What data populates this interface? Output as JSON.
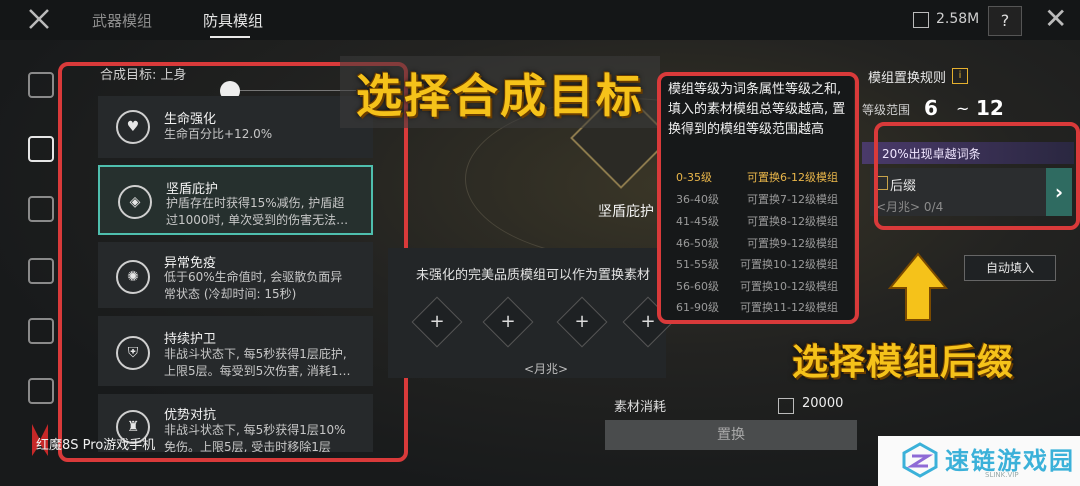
{
  "header": {
    "tabs": [
      {
        "label": "武器模组"
      },
      {
        "label": "防具模组"
      }
    ],
    "storage": "2.58M",
    "help": "?"
  },
  "left": {
    "target_label": "合成目标: 上身",
    "items": [
      {
        "name": "生命强化",
        "desc": "生命百分比+12.0%"
      },
      {
        "name": "坚盾庇护",
        "desc": "护盾存在时获得15%减伤, 护盾超\n过1000时, 单次受到的伤害无法…"
      },
      {
        "name": "异常免疫",
        "desc": "低于60%生命值时, 会驱散负面异\n常状态 (冷却时间: 15秒)"
      },
      {
        "name": "持续护卫",
        "desc": "非战斗状态下, 每5秒获得1层庇护,\n上限5层。每受到5次伤害, 消耗1…"
      },
      {
        "name": "优势对抗",
        "desc": "非战斗状态下, 每5秒获得1层10%\n免伤。上限5层, 受击时移除1层"
      }
    ]
  },
  "center": {
    "banner": "选择合成目标",
    "selected_name": "坚盾庇护",
    "slots_label": "未强化的完美品质模组可以作为置换素材",
    "slot_plus": "+",
    "slot_caption": "<月兆>",
    "cost_label": "素材消耗",
    "cost_value": "20000",
    "replace_button": "置换"
  },
  "popup": {
    "text": "模组等级为词条属性等级之和, 填入的素材模组总等级越高, 置换得到的模组等级范围越高",
    "tiers": [
      {
        "range": "0-35级",
        "result": "可置换6-12级模组"
      },
      {
        "range": "36-40级",
        "result": "可置换7-12级模组"
      },
      {
        "range": "41-45级",
        "result": "可置换8-12级模组"
      },
      {
        "range": "46-50级",
        "result": "可置换9-12级模组"
      },
      {
        "range": "51-55级",
        "result": "可置换10-12级模组"
      },
      {
        "range": "56-60级",
        "result": "可置换10-12级模组"
      },
      {
        "range": "61-90级",
        "result": "可置换11-12级模组"
      }
    ]
  },
  "right": {
    "rule_title": "模组置换规则",
    "info": "i",
    "level_label": "等级范围",
    "level_min": "6",
    "tilde": "~",
    "level_max": "12",
    "bonus": "20%出现卓越词条",
    "suffix_label": "后缀",
    "suffix_count": "<月兆> 0/4",
    "arrow": "›",
    "autofill": "自动填入",
    "callout": "选择模组后缀"
  },
  "footer": {
    "watermark": "红魔8S Pro游戏手机",
    "brand_name": "速链游戏园",
    "brand_sub": "SLINK.VIP"
  },
  "colors": {
    "accent": "#4fbfae",
    "highlight": "#f5c21a",
    "annotation": "#d93a3a"
  }
}
